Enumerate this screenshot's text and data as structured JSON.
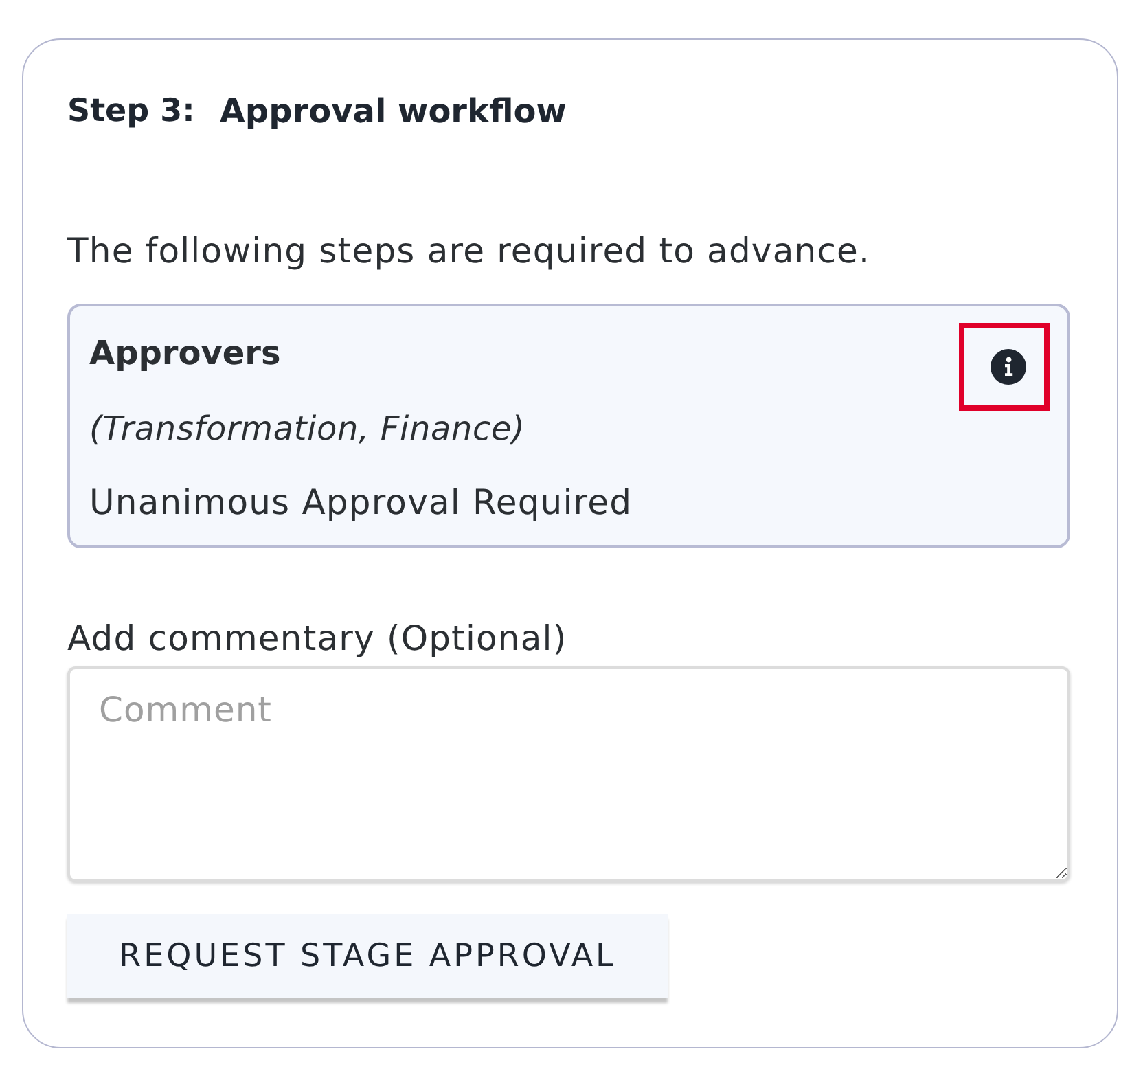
{
  "panel": {
    "step": "Step 3:",
    "title": "Approval workflow",
    "intro": "The following steps are required to advance.",
    "approvers": {
      "heading": "Approvers",
      "groups": "(Transformation, Finance)",
      "rule": "Unanimous Approval Required",
      "info_highlighted": true
    },
    "commentary": {
      "label": "Add commentary (Optional)",
      "placeholder": "Comment"
    },
    "button": "REQUEST STAGE APPROVAL"
  }
}
